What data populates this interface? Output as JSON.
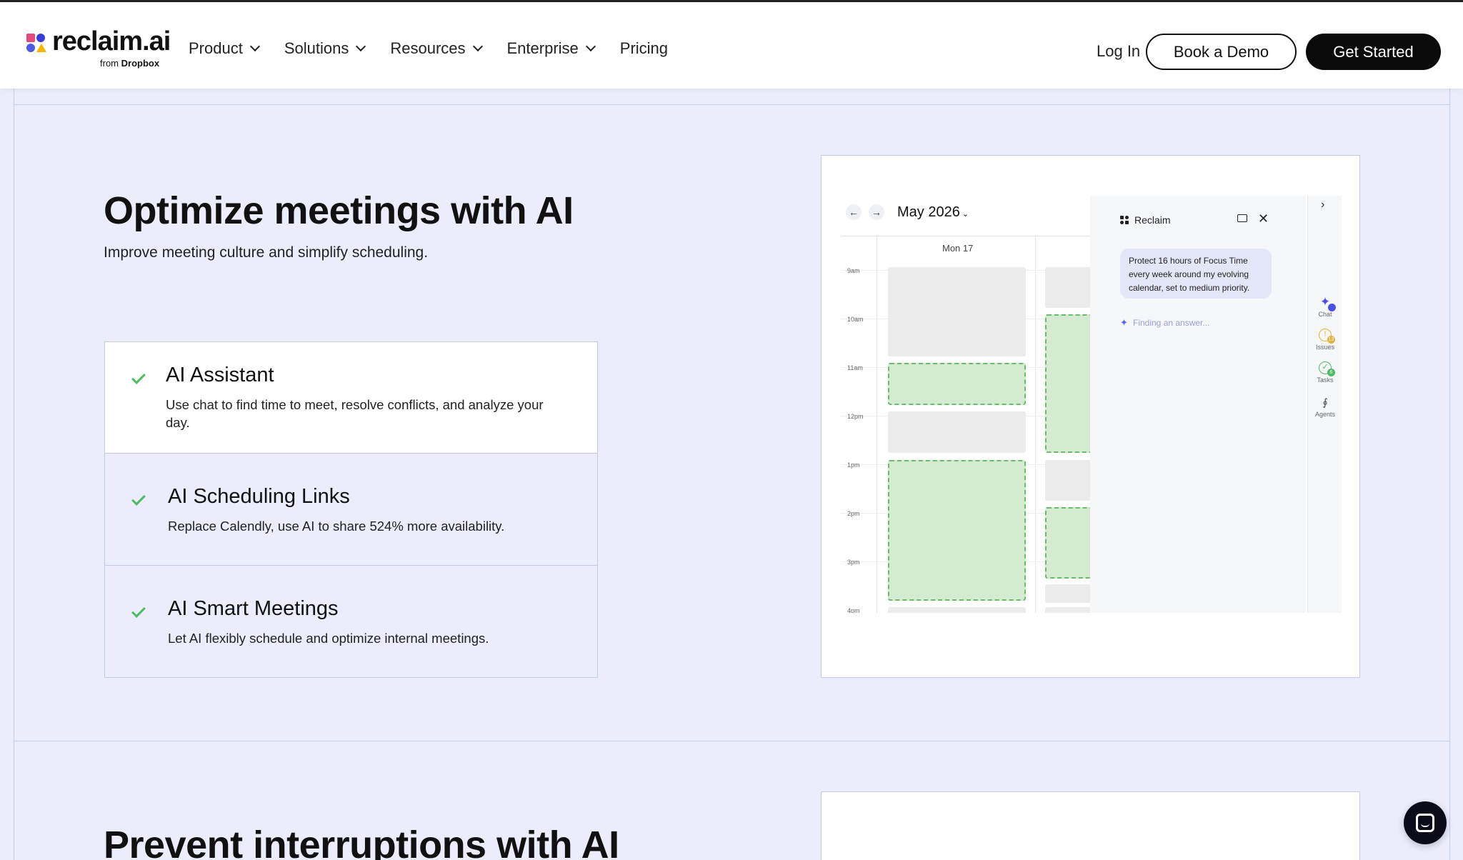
{
  "header": {
    "logo_text": "reclaim.ai",
    "logo_sub_prefix": "from",
    "logo_sub_brand": "Dropbox",
    "nav": [
      {
        "label": "Product",
        "has_menu": true
      },
      {
        "label": "Solutions",
        "has_menu": true
      },
      {
        "label": "Resources",
        "has_menu": true
      },
      {
        "label": "Enterprise",
        "has_menu": true
      },
      {
        "label": "Pricing",
        "has_menu": false
      }
    ],
    "login_label": "Log In",
    "demo_label": "Book a Demo",
    "start_label": "Get Started"
  },
  "section1": {
    "title": "Optimize meetings with AI",
    "subtitle": "Improve meeting culture and simplify scheduling.",
    "features": [
      {
        "title": "AI Assistant",
        "desc": "Use chat to find time to meet, resolve conflicts, and analyze your day.",
        "active": true
      },
      {
        "title": "AI Scheduling Links",
        "desc": "Replace Calendly, use AI to share 524% more availability.",
        "active": false
      },
      {
        "title": "AI Smart Meetings",
        "desc": "Let AI flexibly schedule and optimize internal meetings.",
        "active": false
      }
    ]
  },
  "calendar": {
    "prev_icon": "arrow-left-icon",
    "next_icon": "arrow-right-icon",
    "month": "May 2026",
    "day_label": "Mon 17",
    "times": [
      "9am",
      "10am",
      "11am",
      "12pm",
      "1pm",
      "2pm",
      "3pm",
      "4pm"
    ]
  },
  "assistant": {
    "title": "Reclaim",
    "message": "Protect 16 hours of Focus Time every week around my evolving calendar, set to medium priority.",
    "status": "Finding an answer...",
    "rail": [
      {
        "label": "Chat",
        "icon": "sparkle-icon"
      },
      {
        "label": "Issues",
        "icon": "alert-icon",
        "badge": "13"
      },
      {
        "label": "Tasks",
        "icon": "check-circle-icon",
        "badge": "6"
      },
      {
        "label": "Agents",
        "icon": "agents-icon"
      }
    ]
  },
  "section2": {
    "title": "Prevent interruptions with AI"
  },
  "colors": {
    "page_bg": "#ebecfc",
    "accent_green": "#4fba62",
    "event_green": "#d4ebd2",
    "event_grey": "#ebebeb",
    "primary_button": "#0a0a0a"
  }
}
